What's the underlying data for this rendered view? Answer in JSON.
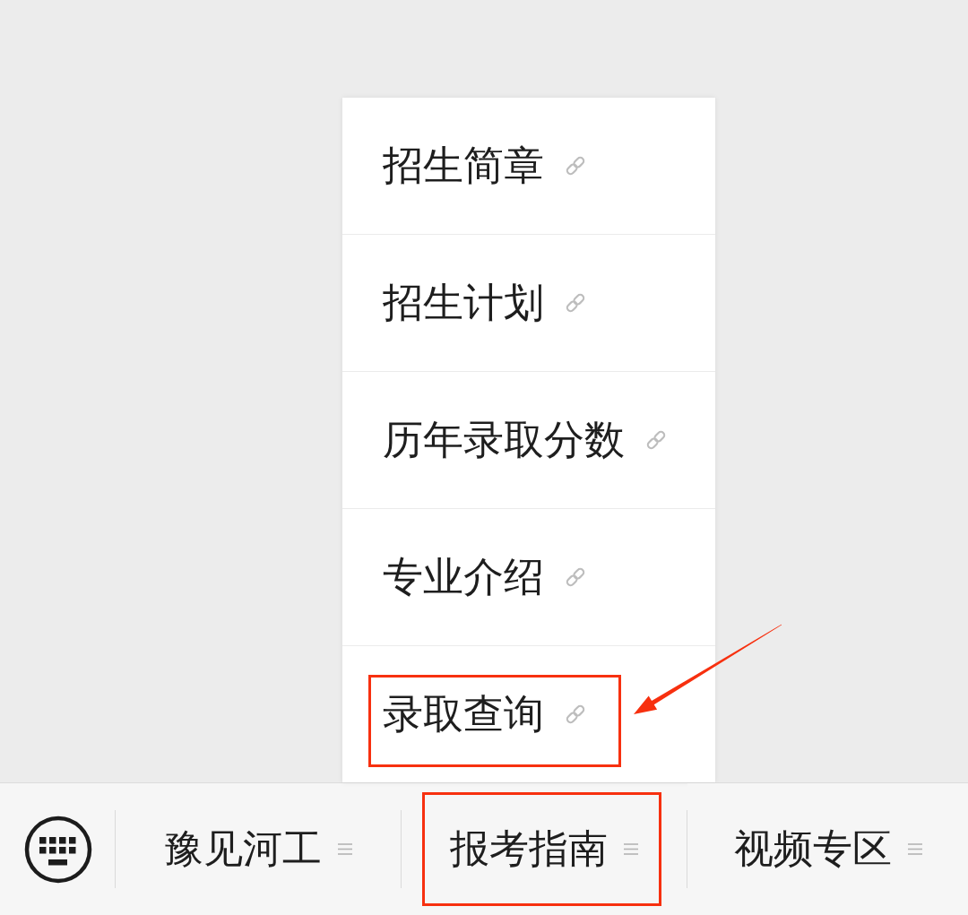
{
  "menu_bar": {
    "items": [
      {
        "label": "豫见河工",
        "highlighted": false
      },
      {
        "label": "报考指南",
        "highlighted": true,
        "submenu": [
          {
            "label": "招生简章",
            "highlighted": false,
            "arrow": false
          },
          {
            "label": "招生计划",
            "highlighted": false,
            "arrow": false
          },
          {
            "label": "历年录取分数",
            "highlighted": false,
            "arrow": false
          },
          {
            "label": "专业介绍",
            "highlighted": false,
            "arrow": false
          },
          {
            "label": "录取查询",
            "highlighted": true,
            "arrow": true
          }
        ]
      },
      {
        "label": "视频专区",
        "highlighted": false
      }
    ]
  }
}
